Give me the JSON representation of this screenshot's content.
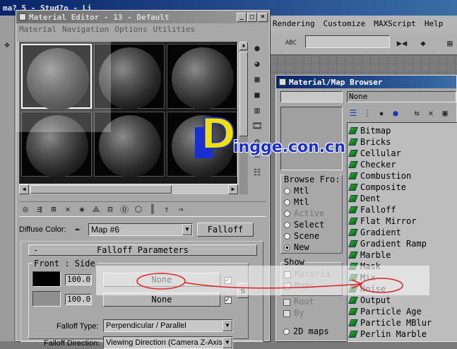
{
  "app_bar": {
    "partial_title": "ma? 5 - Stud?o - Li",
    "menu": [
      "Rendering",
      "Customize",
      "MAXScript",
      "Help"
    ],
    "toolbar_label_abc": "ABC"
  },
  "material_editor": {
    "title": "Material Editor - 13 - Default",
    "menu": [
      "Material",
      "Navigation",
      "Options",
      "Utilities"
    ],
    "diffuse_label": "Diffuse Color:",
    "map_name": "Map #6",
    "map_type_button": "Falloff",
    "rollout_collapse": "-",
    "rollout_title": "Falloff Parameters",
    "front_side_label": "Front : Side",
    "row1": {
      "amount": "100.0",
      "map_button": "None",
      "checked": true
    },
    "row2": {
      "amount": "100.0",
      "map_button": "None",
      "checked": true
    },
    "falloff_type_label": "Falloff Type:",
    "falloff_type_value": "Perpendicular / Parallel",
    "falloff_direction_label": "Falloff Direction:",
    "falloff_direction_value": "Viewing Direction (Camera Z-Axis)",
    "swap_icon": "swap-icon"
  },
  "browser": {
    "title": "Material/Map Browser",
    "name_field": "None",
    "browse_from_label": "Browse Fro:",
    "browse_options": [
      {
        "label": "Mtl",
        "selected": false,
        "enabled": true
      },
      {
        "label": "Mtl",
        "selected": false,
        "enabled": true
      },
      {
        "label": "Active",
        "selected": false,
        "enabled": false
      },
      {
        "label": "Select",
        "selected": false,
        "enabled": true
      },
      {
        "label": "Scene",
        "selected": false,
        "enabled": true
      },
      {
        "label": "New",
        "selected": true,
        "enabled": true
      }
    ],
    "show_label": "Show",
    "show_options": [
      {
        "label": "Materia",
        "checked": false,
        "enabled": false
      },
      {
        "label": "Maps",
        "checked": true,
        "enabled": false
      }
    ],
    "extra_options": [
      {
        "label": "Root",
        "enabled": false
      },
      {
        "label": "By",
        "enabled": false
      }
    ],
    "view_options": [
      {
        "label": "2D maps",
        "selected": false
      }
    ],
    "items": [
      "Bitmap",
      "Bricks",
      "Cellular",
      "Checker",
      "Combustion",
      "Composite",
      "Dent",
      "Falloff",
      "Flat Mirror",
      "Gradient",
      "Gradient Ramp",
      "Marble",
      "Mask",
      "Mix",
      "Noise",
      "Output",
      "Particle Age",
      "Particle MBlur",
      "Perlin Marble"
    ]
  },
  "watermark": {
    "logo_letter": "D",
    "text": "ingge.con.cn"
  },
  "colors": {
    "title_active": "#0a246a",
    "panel": "#a8a8a8",
    "watermark_blue": "#1a2fd0",
    "watermark_yellow": "#f2e000",
    "annotation_red": "#e02020"
  }
}
